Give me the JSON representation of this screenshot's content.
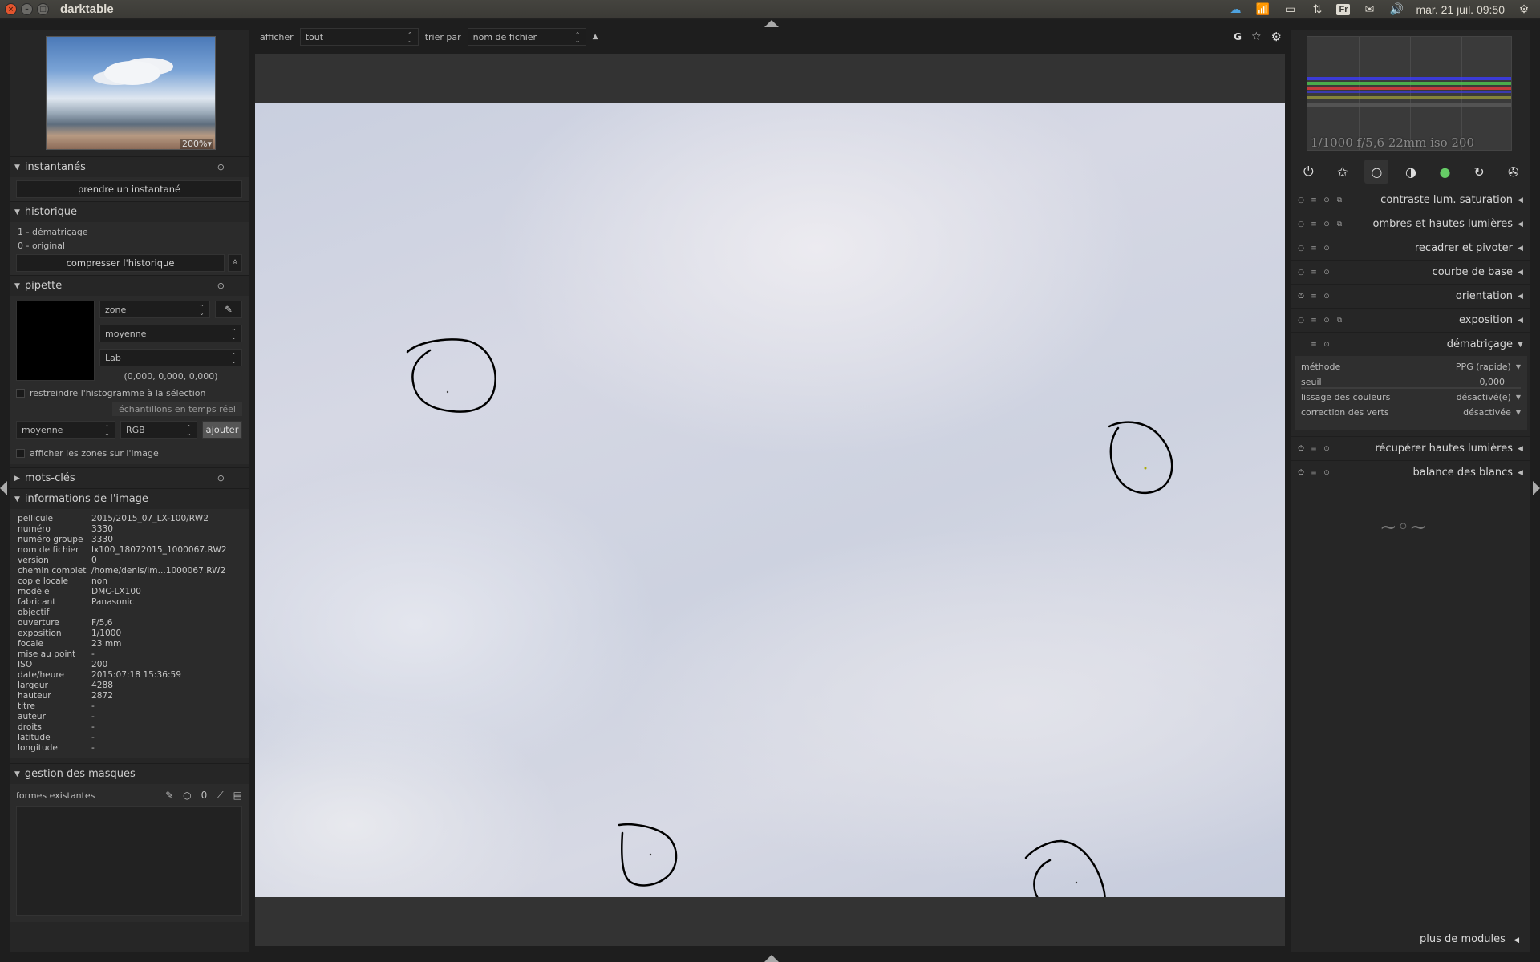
{
  "window": {
    "title": "darktable"
  },
  "tray": {
    "keyboard": "Fr",
    "clock": "mar. 21 juil. 09:50"
  },
  "topbar": {
    "filter_label": "afficher",
    "filter_value": "tout",
    "sort_label": "trier par",
    "sort_value": "nom de fichier",
    "sort_dir": "▲",
    "grouping": "G"
  },
  "navigation": {
    "zoom": "200%▾"
  },
  "snapshots": {
    "title": "instantanés",
    "button": "prendre un instantané"
  },
  "history": {
    "title": "historique",
    "items": [
      "1 - dématriçage",
      "0 - original"
    ],
    "compress_button": "compresser l'historique"
  },
  "colorpicker": {
    "title": "pipette",
    "mode": "zone",
    "stat": "moyenne",
    "colorspace": "Lab",
    "values": "(0,000, 0,000, 0,000)",
    "restrict_label": "restreindre l'histogramme à la sélection",
    "live_samples_label": "échantillons en temps réel",
    "sample_stat": "moyenne",
    "sample_space": "RGB",
    "add_button": "ajouter",
    "show_zones_label": "afficher les zones sur l'image"
  },
  "tagging": {
    "title": "mots-clés"
  },
  "image_info": {
    "title": "informations de l'image",
    "rows": [
      [
        "pellicule",
        "2015/2015_07_LX-100/RW2"
      ],
      [
        "numéro",
        "3330"
      ],
      [
        "numéro groupe",
        "3330"
      ],
      [
        "nom de fichier",
        "lx100_18072015_1000067.RW2"
      ],
      [
        "version",
        "0"
      ],
      [
        "chemin complet",
        "/home/denis/Im...1000067.RW2"
      ],
      [
        "copie locale",
        "non"
      ],
      [
        "modèle",
        "DMC-LX100"
      ],
      [
        "fabricant",
        "Panasonic"
      ],
      [
        "objectif",
        ""
      ],
      [
        "ouverture",
        "F/5,6"
      ],
      [
        "exposition",
        "1/1000"
      ],
      [
        "focale",
        "23 mm"
      ],
      [
        "mise au point",
        "-"
      ],
      [
        "ISO",
        "200"
      ],
      [
        "date/heure",
        "2015:07:18 15:36:59"
      ],
      [
        "largeur",
        "4288"
      ],
      [
        "hauteur",
        "2872"
      ],
      [
        "titre",
        "-"
      ],
      [
        "auteur",
        "-"
      ],
      [
        "droits",
        "-"
      ],
      [
        "latitude",
        "-"
      ],
      [
        "longitude",
        "-"
      ]
    ]
  },
  "masks": {
    "title": "gestion des masques",
    "existing_shapes": "formes existantes"
  },
  "histogram": {
    "exif": "1/1000 f/5,6 22mm iso 200"
  },
  "modules": [
    {
      "label": "contraste lum. saturation"
    },
    {
      "label": "ombres et hautes lumières"
    },
    {
      "label": "recadrer et pivoter"
    },
    {
      "label": "courbe de base"
    },
    {
      "label": "orientation"
    },
    {
      "label": "exposition"
    },
    {
      "label": "dématriçage"
    },
    {
      "label": "récupérer hautes lumières"
    },
    {
      "label": "balance des blancs"
    }
  ],
  "demosaic": {
    "method_label": "méthode",
    "method_value": "PPG (rapide)",
    "threshold_label": "seuil",
    "threshold_value": "0,000",
    "smoothing_label": "lissage des couleurs",
    "smoothing_value": "désactivé(e)",
    "green_label": "correction des verts",
    "green_value": "désactivée"
  },
  "more_modules": "plus de modules"
}
